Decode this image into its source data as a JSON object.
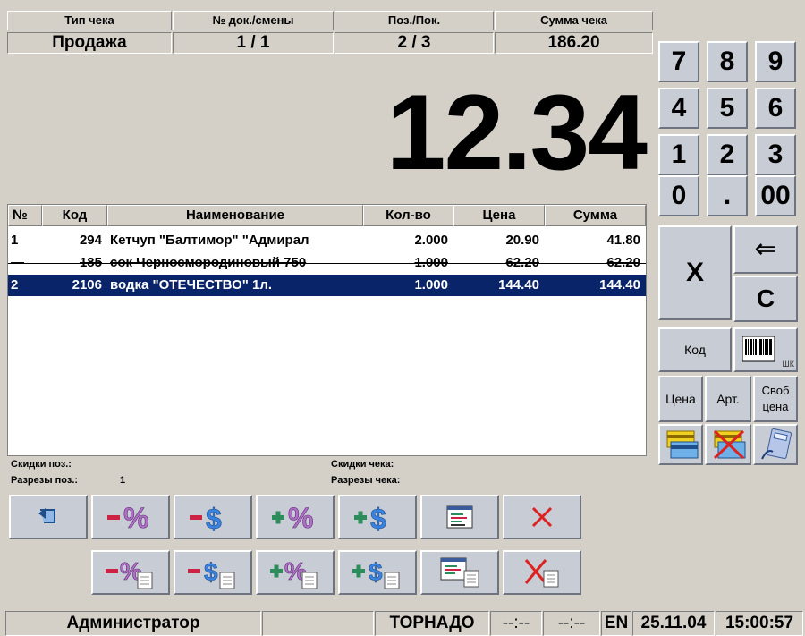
{
  "header": {
    "type_label": "Тип чека",
    "doc_label": "№ док./смены",
    "pos_label": "Поз./Пок.",
    "sum_label": "Сумма чека",
    "type_value": "Продажа",
    "doc_value": "1 / 1",
    "pos_value": "2 / 3",
    "sum_value": "186.20"
  },
  "display": {
    "amount": "12.34"
  },
  "table": {
    "columns": [
      "№",
      "Код",
      "Наименование",
      "Кол-во",
      "Цена",
      "Сумма"
    ],
    "rows": [
      {
        "num": "1",
        "code": "294",
        "name": "Кетчуп \"Балтимор\" \"Адмирал",
        "qty": "2.000",
        "price": "20.90",
        "sum": "41.80"
      },
      {
        "num": "—",
        "code": "185",
        "name": "сок Черносмородиновый 750",
        "qty": "1.000",
        "price": "62.20",
        "sum": "62.20"
      },
      {
        "num": "2",
        "code": "2106",
        "name": "водка \"ОТЕЧЕСТВО\" 1л.",
        "qty": "1.000",
        "price": "144.40",
        "sum": "144.40"
      }
    ]
  },
  "info": {
    "pos_discount_label": "Скидки поз.:",
    "pos_cuts_label": "Разрезы поз.:",
    "pos_cuts_value": "1",
    "check_discount_label": "Скидки чека:",
    "check_cuts_label": "Разрезы чека:"
  },
  "keypad": {
    "k7": "7",
    "k8": "8",
    "k9": "9",
    "k4": "4",
    "k5": "5",
    "k6": "6",
    "k1": "1",
    "k2": "2",
    "k3": "3",
    "k0": "0",
    "kdot": ".",
    "k00": "00",
    "multiply": "X",
    "backspace": "⇐",
    "clear": "C",
    "code": "Код",
    "barcode_suffix": "ШК",
    "price": "Цена",
    "article": "Арт.",
    "free_price": "Своб цена"
  },
  "status": {
    "user": "Администратор",
    "cashier_name": "ТОРНАДО",
    "time_a": "--:--",
    "time_b": "--:--",
    "lang": "EN",
    "date": "25.11.04",
    "time": "15:00:57"
  },
  "colors": {
    "selection": "#0a246a",
    "minus": "#cc2244",
    "plus": "#2c8c5c",
    "x_red": "#dd2222"
  }
}
